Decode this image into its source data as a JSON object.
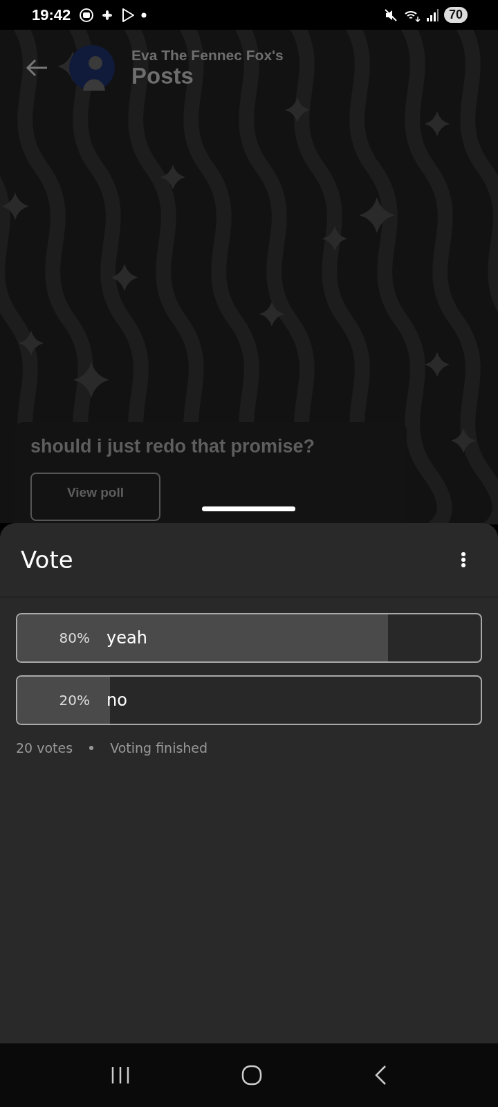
{
  "status_bar": {
    "time": "19:42",
    "battery": "70"
  },
  "header": {
    "subtitle": "Eva The Fennec Fox's",
    "title": "Posts"
  },
  "post": {
    "text": "should i just redo that promise?",
    "button": "View poll"
  },
  "sheet": {
    "title": "Vote",
    "options": [
      {
        "percent": "80%",
        "label": "yeah",
        "level": 0.8
      },
      {
        "percent": "20%",
        "label": "no",
        "level": 0.2
      }
    ],
    "votes": "20 votes",
    "status": "Voting finished"
  }
}
